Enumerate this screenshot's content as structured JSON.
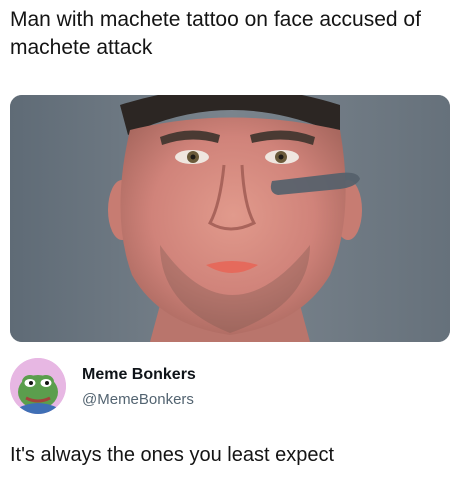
{
  "post": {
    "headline": "Man with machete tattoo on face accused of machete attack",
    "image": {
      "subject": "mugshot-man-face-tattoo",
      "colors": {
        "background": "#6e7882",
        "skin": "#d98a7c",
        "tattoo": "#55616b"
      }
    }
  },
  "tweet": {
    "author_name": "Meme Bonkers",
    "author_handle": "@MemeBonkers",
    "avatar": {
      "icon": "pepe-frog-avatar",
      "ring_color": "#e7b7e3"
    },
    "text": "It's always the ones you least expect"
  }
}
